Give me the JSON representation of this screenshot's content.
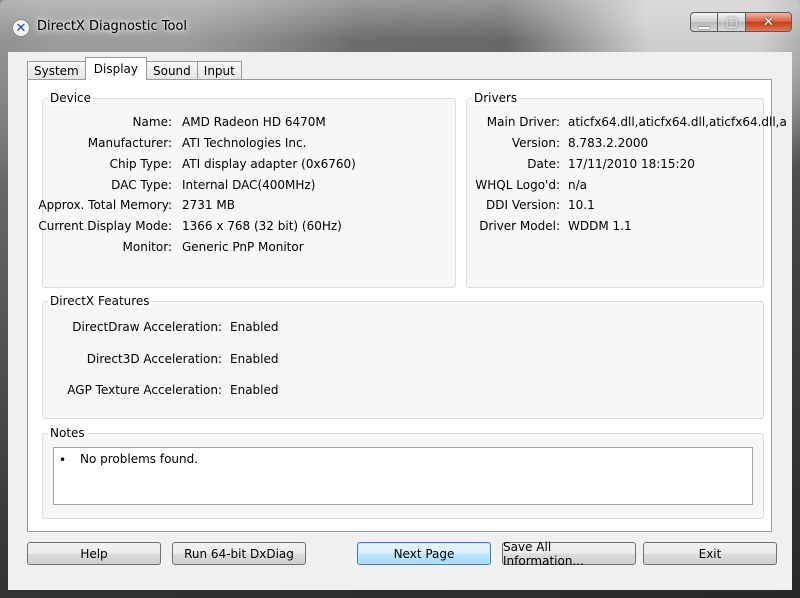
{
  "window": {
    "title": "DirectX Diagnostic Tool",
    "icon": "directx-icon"
  },
  "tabs": [
    {
      "label": "System",
      "active": false
    },
    {
      "label": "Display",
      "active": true
    },
    {
      "label": "Sound",
      "active": false
    },
    {
      "label": "Input",
      "active": false
    }
  ],
  "device": {
    "heading": "Device",
    "fields": [
      {
        "label": "Name:",
        "value": "AMD Radeon HD 6470M"
      },
      {
        "label": "Manufacturer:",
        "value": "ATI Technologies Inc."
      },
      {
        "label": "Chip Type:",
        "value": "ATI display adapter (0x6760)"
      },
      {
        "label": "DAC Type:",
        "value": "Internal DAC(400MHz)"
      },
      {
        "label": "Approx. Total Memory:",
        "value": "2731 MB"
      },
      {
        "label": "Current Display Mode:",
        "value": "1366 x 768 (32 bit) (60Hz)"
      },
      {
        "label": "Monitor:",
        "value": "Generic PnP Monitor"
      }
    ]
  },
  "drivers": {
    "heading": "Drivers",
    "fields": [
      {
        "label": "Main Driver:",
        "value": "aticfx64.dll,aticfx64.dll,aticfx64.dll,a"
      },
      {
        "label": "Version:",
        "value": "8.783.2.2000"
      },
      {
        "label": "Date:",
        "value": "17/11/2010 18:15:20"
      },
      {
        "label": "WHQL Logo'd:",
        "value": "n/a"
      },
      {
        "label": "DDI Version:",
        "value": "10.1"
      },
      {
        "label": "Driver Model:",
        "value": "WDDM 1.1"
      }
    ]
  },
  "features": {
    "heading": "DirectX Features",
    "fields": [
      {
        "label": "DirectDraw Acceleration:",
        "value": "Enabled"
      },
      {
        "label": "Direct3D Acceleration:",
        "value": "Enabled"
      },
      {
        "label": "AGP Texture Acceleration:",
        "value": "Enabled"
      }
    ]
  },
  "notes": {
    "heading": "Notes",
    "bullet": "•",
    "items": [
      "No problems found."
    ]
  },
  "buttons": {
    "help": "Help",
    "run64": "Run 64-bit DxDiag",
    "next": "Next Page",
    "save": "Save All Information...",
    "exit": "Exit"
  }
}
